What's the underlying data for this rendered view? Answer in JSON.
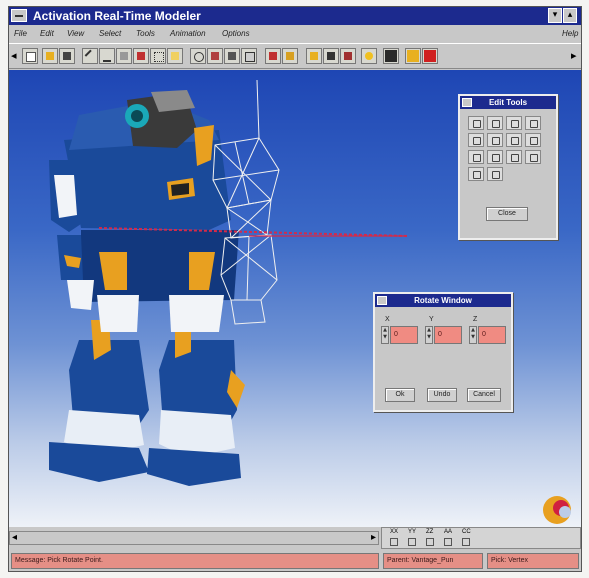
{
  "window": {
    "title": "Activation Real-Time Modeler",
    "controls": {
      "minimize": "▾",
      "maximize": "▴"
    },
    "help_label": "Help"
  },
  "menu": {
    "items": [
      "File",
      "Edit",
      "View",
      "Select",
      "Tools",
      "Animation",
      "Options"
    ]
  },
  "toolbar": {
    "left_arrow": "◂",
    "right_arrow": "▸",
    "color_swatches": [
      "#2a2a2a",
      "#e8b020",
      "#d02020"
    ]
  },
  "edit_tools": {
    "title": "Edit Tools",
    "close_label": "Close"
  },
  "rotate_window": {
    "title": "Rotate Window",
    "axes": [
      {
        "label": "X",
        "value": "0"
      },
      {
        "label": "Y",
        "value": "0"
      },
      {
        "label": "Z",
        "value": "0"
      }
    ],
    "ok_label": "Ok",
    "undo_label": "Undo",
    "cancel_label": "Cancel"
  },
  "scroll": {
    "left_arrow": "◂",
    "right_arrow": "▸"
  },
  "coord_labels": [
    "XX",
    "YY",
    "ZZ",
    "AA",
    "CC"
  ],
  "status": {
    "message": "Message: Pick Rotate Point.",
    "parent": "Parent: Vantage_Pun",
    "pick": "Pick: Vertex"
  },
  "colors": {
    "title_bar": "#1c2a8e",
    "viewport_top": "#1e46b4",
    "field_pink": "#f08b82",
    "robot_blue": "#1a4a9a",
    "robot_yellow": "#e8a020",
    "selection_red": "#d42a4a"
  }
}
